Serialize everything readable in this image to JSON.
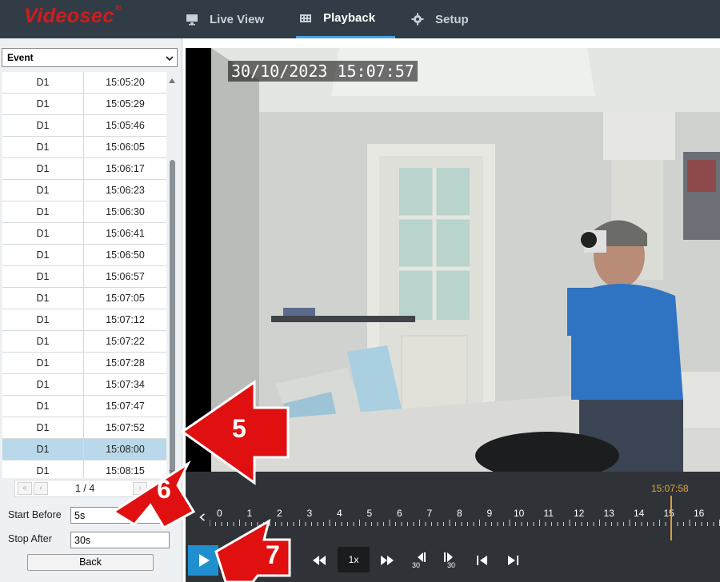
{
  "app": {
    "brand": "Videosec",
    "brand_mark": "®"
  },
  "nav": {
    "tabs": [
      {
        "label": "Live View",
        "icon": "monitor-icon",
        "active": false
      },
      {
        "label": "Playback",
        "icon": "film-icon",
        "active": true
      },
      {
        "label": "Setup",
        "icon": "gear-icon",
        "active": false
      }
    ]
  },
  "sidebar": {
    "mode_select": "Event",
    "events": [
      {
        "channel": "D1",
        "time": "15:05:20"
      },
      {
        "channel": "D1",
        "time": "15:05:29"
      },
      {
        "channel": "D1",
        "time": "15:05:46"
      },
      {
        "channel": "D1",
        "time": "15:06:05"
      },
      {
        "channel": "D1",
        "time": "15:06:17"
      },
      {
        "channel": "D1",
        "time": "15:06:23"
      },
      {
        "channel": "D1",
        "time": "15:06:30"
      },
      {
        "channel": "D1",
        "time": "15:06:41"
      },
      {
        "channel": "D1",
        "time": "15:06:50"
      },
      {
        "channel": "D1",
        "time": "15:06:57"
      },
      {
        "channel": "D1",
        "time": "15:07:05"
      },
      {
        "channel": "D1",
        "time": "15:07:12"
      },
      {
        "channel": "D1",
        "time": "15:07:22"
      },
      {
        "channel": "D1",
        "time": "15:07:28"
      },
      {
        "channel": "D1",
        "time": "15:07:34"
      },
      {
        "channel": "D1",
        "time": "15:07:47"
      },
      {
        "channel": "D1",
        "time": "15:07:52"
      },
      {
        "channel": "D1",
        "time": "15:08:00",
        "selected": true
      },
      {
        "channel": "D1",
        "time": "15:08:15"
      }
    ],
    "pager": {
      "text": "1 / 4",
      "first": "«",
      "prev": "‹",
      "next": "›"
    },
    "start_before": {
      "label": "Start Before",
      "value": "5s"
    },
    "stop_after": {
      "label": "Stop After",
      "value": "30s"
    },
    "back_label": "Back"
  },
  "video": {
    "osd_timestamp": "30/10/2023 15:07:57"
  },
  "timeline": {
    "current_time": "15:07:58",
    "hour_ticks": [
      "0",
      "1",
      "2",
      "3",
      "4",
      "5",
      "6",
      "7",
      "8",
      "9",
      "10",
      "11",
      "12",
      "13",
      "14",
      "15",
      "16"
    ],
    "speed": "1x",
    "skip_back_label": "30",
    "skip_fwd_label": "30"
  },
  "annotations": [
    "5",
    "6",
    "7"
  ],
  "colors": {
    "topbar": "#323c46",
    "accent": "#1f8fd0",
    "brand": "#d01c1c",
    "selected_row": "#b9d9ea",
    "annotation_red": "#e01010",
    "timeline_marker": "#d6a23b"
  }
}
